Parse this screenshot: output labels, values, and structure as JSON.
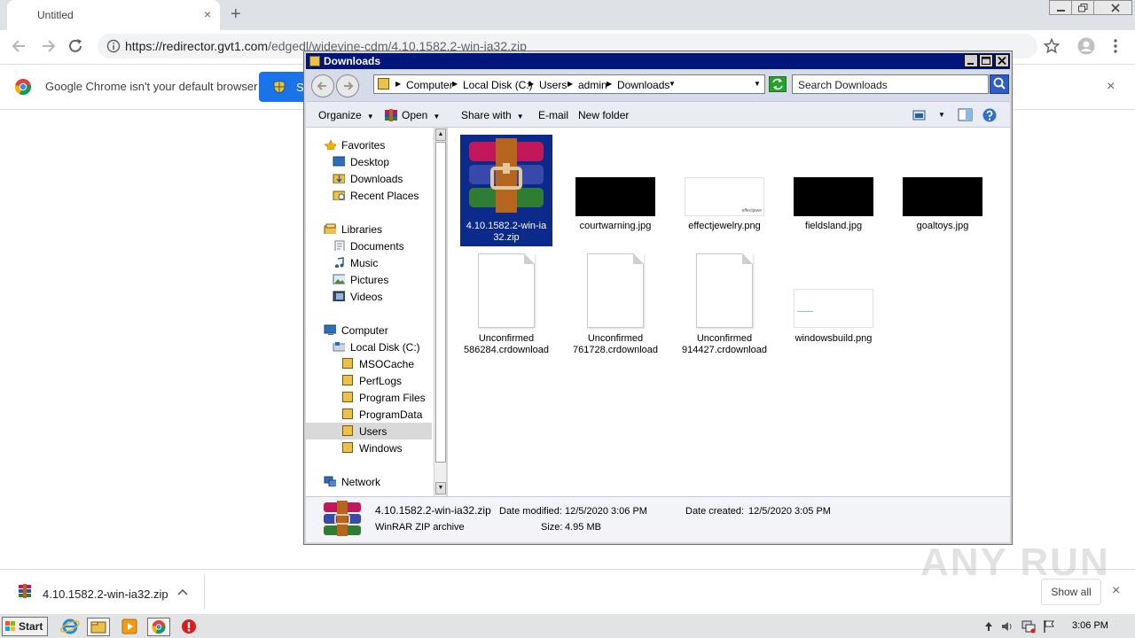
{
  "chrome": {
    "tab_title": "Untitled",
    "tab_close": "×",
    "new_tab": "+",
    "url_host": "https://redirector.gvt1.com",
    "url_path": "/edgedl/widevine-cdm/4.10.1582.2-win-ia32.zip",
    "infobar_text": "Google Chrome isn't your default browser",
    "infobar_button_label": "S",
    "infobar_close": "×"
  },
  "explorer": {
    "title": "Downloads",
    "breadcrumbs": [
      "Computer",
      "Local Disk (C:)",
      "Users",
      "admin",
      "Downloads"
    ],
    "search_placeholder": "Search Downloads",
    "commands": {
      "organize": "Organize",
      "open": "Open",
      "share_with": "Share with",
      "email": "E-mail",
      "new_folder": "New folder"
    },
    "nav": {
      "favorites": "Favorites",
      "desktop": "Desktop",
      "downloads": "Downloads",
      "recent_places": "Recent Places",
      "libraries": "Libraries",
      "documents": "Documents",
      "music": "Music",
      "pictures": "Pictures",
      "videos": "Videos",
      "computer": "Computer",
      "local_disk": "Local Disk (C:)",
      "msocache": "MSOCache",
      "perflogs": "PerfLogs",
      "program_files": "Program Files",
      "programdata": "ProgramData",
      "users": "Users",
      "windows": "Windows",
      "network": "Network"
    },
    "files": {
      "zip": {
        "line1": "4.10.1582.2-win-ia",
        "line2": "32.zip"
      },
      "courtwarning": "courtwarning.jpg",
      "effectjewelry": "effectjewelry.png",
      "effectjewelry_thumb_text": "effectjewe",
      "fieldsland": "fieldsland.jpg",
      "goaltoys": "goaltoys.jpg",
      "cr1": {
        "line1": "Unconfirmed",
        "line2": "586284.crdownload"
      },
      "cr2": {
        "line1": "Unconfirmed",
        "line2": "761728.crdownload"
      },
      "cr3": {
        "line1": "Unconfirmed",
        "line2": "914427.crdownload"
      },
      "windowsbuild": "windowsbuild.png"
    },
    "details": {
      "name": "4.10.1582.2-win-ia32.zip",
      "type": "WinRAR ZIP archive",
      "modified_label": "Date modified:",
      "modified_value": "12/5/2020 3:06 PM",
      "created_label": "Date created:",
      "created_value": "12/5/2020 3:05 PM",
      "size_label": "Size:",
      "size_value": "4.95 MB"
    }
  },
  "download_shelf": {
    "file_name": "4.10.1582.2-win-ia32.zip",
    "show_all": "Show all",
    "close": "×"
  },
  "watermark": "ANY RUN",
  "taskbar": {
    "start": "Start",
    "clock": "3:06 PM"
  }
}
